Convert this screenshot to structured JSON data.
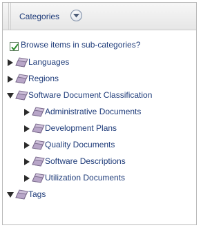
{
  "header": {
    "title": "Categories"
  },
  "browse": {
    "label": "Browse items in sub-categories?",
    "checked": true
  },
  "tree": {
    "items": [
      {
        "label": "Languages",
        "expanded": false
      },
      {
        "label": "Regions",
        "expanded": false
      },
      {
        "label": "Software Document Classification",
        "expanded": true,
        "children": [
          {
            "label": "Administrative Documents"
          },
          {
            "label": "Development Plans"
          },
          {
            "label": "Quality Documents"
          },
          {
            "label": "Software Descriptions"
          },
          {
            "label": "Utilization Documents"
          }
        ]
      },
      {
        "label": "Tags",
        "expanded": true
      }
    ]
  },
  "colors": {
    "link": "#1f3c7a",
    "check": "#2e8b2e",
    "folder": "#b8a6c8"
  }
}
